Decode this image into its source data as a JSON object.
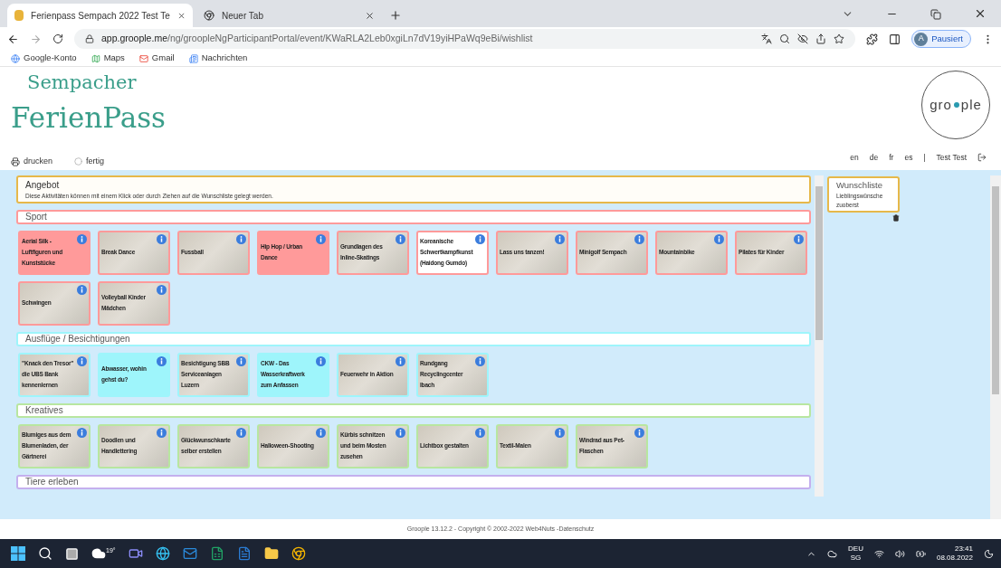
{
  "browser": {
    "tabs": [
      {
        "title": "Ferienpass Sempach 2022 Test Te",
        "selected": true
      },
      {
        "title": "Neuer Tab",
        "selected": false
      }
    ],
    "url_host": "app.groople.me",
    "url_path": "/ng/groopleNgParticipantPortal/event/KWaRLA2Leb0xgiLn7dV19yiHPaWq9eBi/wishlist",
    "profile": {
      "initial": "A",
      "status": "Pausiert"
    },
    "bookmarks": [
      "Google-Konto",
      "Maps",
      "Gmail",
      "Nachrichten"
    ]
  },
  "header": {
    "logo_line1": "Sempacher",
    "logo_line2": "FerienPass",
    "brand_left": "gro",
    "brand_right": "ple",
    "actions": [
      "drucken",
      "fertig"
    ],
    "languages": [
      "en",
      "de",
      "fr",
      "es"
    ],
    "separator": "|",
    "user": "Test Test"
  },
  "offer": {
    "title": "Angebot",
    "description": "Diese Aktivitäten können mit einem Klick oder durch Ziehen auf die Wunschliste gelegt werden."
  },
  "categories": [
    {
      "name": "Sport",
      "color": "#ff9a9a",
      "activities": [
        {
          "name": "Aerial Silk - Luftfiguren und Kunststücke",
          "kind": "filled"
        },
        {
          "name": "Break Dance",
          "kind": "photo"
        },
        {
          "name": "Fussball",
          "kind": "photo"
        },
        {
          "name": "Hip Hop / Urban Dance",
          "kind": "filled"
        },
        {
          "name": "Grundlagen des Inline-Skatings",
          "kind": "photo"
        },
        {
          "name": "Koreanische Schwertkampfkunst (Haidong Gumdo)",
          "kind": "blank"
        },
        {
          "name": "Lass uns tanzen!",
          "kind": "photo"
        },
        {
          "name": "Minigolf Sempach",
          "kind": "photo"
        },
        {
          "name": "Mountainbike",
          "kind": "photo"
        },
        {
          "name": "Pilates für Kinder",
          "kind": "photo"
        },
        {
          "name": "Schwingen",
          "kind": "photo"
        },
        {
          "name": "Volleyball Kinder Mädchen",
          "kind": "photo"
        }
      ]
    },
    {
      "name": "Ausflüge / Besichtigungen",
      "color": "#9ef5fb",
      "activities": [
        {
          "name": "\"Knack den Tresor\" die UBS Bank kennenlernen",
          "kind": "photo"
        },
        {
          "name": "Abwasser, wohin gehst du?",
          "kind": "filled"
        },
        {
          "name": "Besichtigung SBB Serviceanlagen Luzern",
          "kind": "photo"
        },
        {
          "name": "CKW - Das Wasserkraftwerk zum Anfassen",
          "kind": "filled"
        },
        {
          "name": "Feuerwehr in Aktion",
          "kind": "photo"
        },
        {
          "name": "Rundgang Recyclingcenter Ibach",
          "kind": "photo"
        }
      ]
    },
    {
      "name": "Kreatives",
      "color": "#b8e6a0",
      "activities": [
        {
          "name": "Blumiges aus dem Blumenladen, der Gärtnerei",
          "kind": "photo"
        },
        {
          "name": "Doodlen und Handlettering",
          "kind": "photo"
        },
        {
          "name": "Glückwunschkarte selber erstellen",
          "kind": "photo"
        },
        {
          "name": "Halloween-Shooting",
          "kind": "photo"
        },
        {
          "name": "Kürbis schnitzen und beim Mosten zusehen",
          "kind": "photo"
        },
        {
          "name": "Lichtbox gestalten",
          "kind": "photo"
        },
        {
          "name": "Textil-Malen",
          "kind": "photo"
        },
        {
          "name": "Windrad aus Pet-Flaschen",
          "kind": "photo"
        }
      ]
    },
    {
      "name": "Tiere erleben",
      "color": "#c4b0ee"
    }
  ],
  "wishlist": {
    "title": "Wunschliste",
    "subtitle": "Lieblingswünsche zuoberst"
  },
  "footer": {
    "text": "Groople 13.12.2 - Copyright © 2002-2022 Web4Nuts -",
    "link": "Datenschutz"
  },
  "taskbar": {
    "weather": "19°",
    "language": "DEU",
    "region": "SG",
    "time": "23:41",
    "date": "08.08.2022"
  }
}
